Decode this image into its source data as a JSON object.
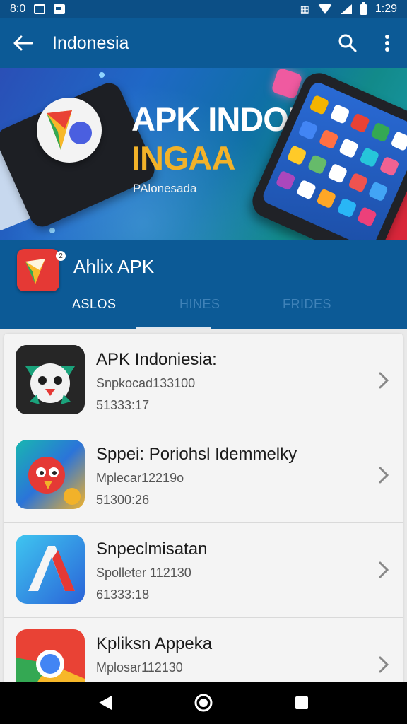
{
  "status_bar": {
    "time_left": "8:0",
    "time_right": "1:29"
  },
  "app_bar": {
    "title": "Indonesia"
  },
  "banner": {
    "title_line1": "APK INDONSA",
    "title_line2": "INGAA",
    "subtitle": "PAlonesada"
  },
  "store": {
    "name": "Ahlix APK",
    "badge": "2",
    "tabs": [
      {
        "label": "ASLOS"
      },
      {
        "label": "HINES"
      },
      {
        "label": "FRIDES"
      }
    ],
    "active_tab": "ASLOS"
  },
  "apps": [
    {
      "title": "APK Indoniesia:",
      "line1": "Snpkocad133100",
      "line2": "51333:17",
      "icon": "cartoon-bird-icon"
    },
    {
      "title": "Sppei: Poriohsl Idemmelky",
      "line1": "Mplecar12219o",
      "line2": "51300:26",
      "icon": "red-bird-icon"
    },
    {
      "title": "Snpeclmisatan",
      "line1": "Spolleter 112130",
      "line2": "61333:18",
      "icon": "letter-a-icon"
    },
    {
      "title": "Kpliksn Appeka",
      "line1": "Mplosar112130",
      "line2": "",
      "icon": "chrome-icon"
    }
  ],
  "colors": {
    "primary": "#0c5a96",
    "accent": "#f2b229"
  }
}
